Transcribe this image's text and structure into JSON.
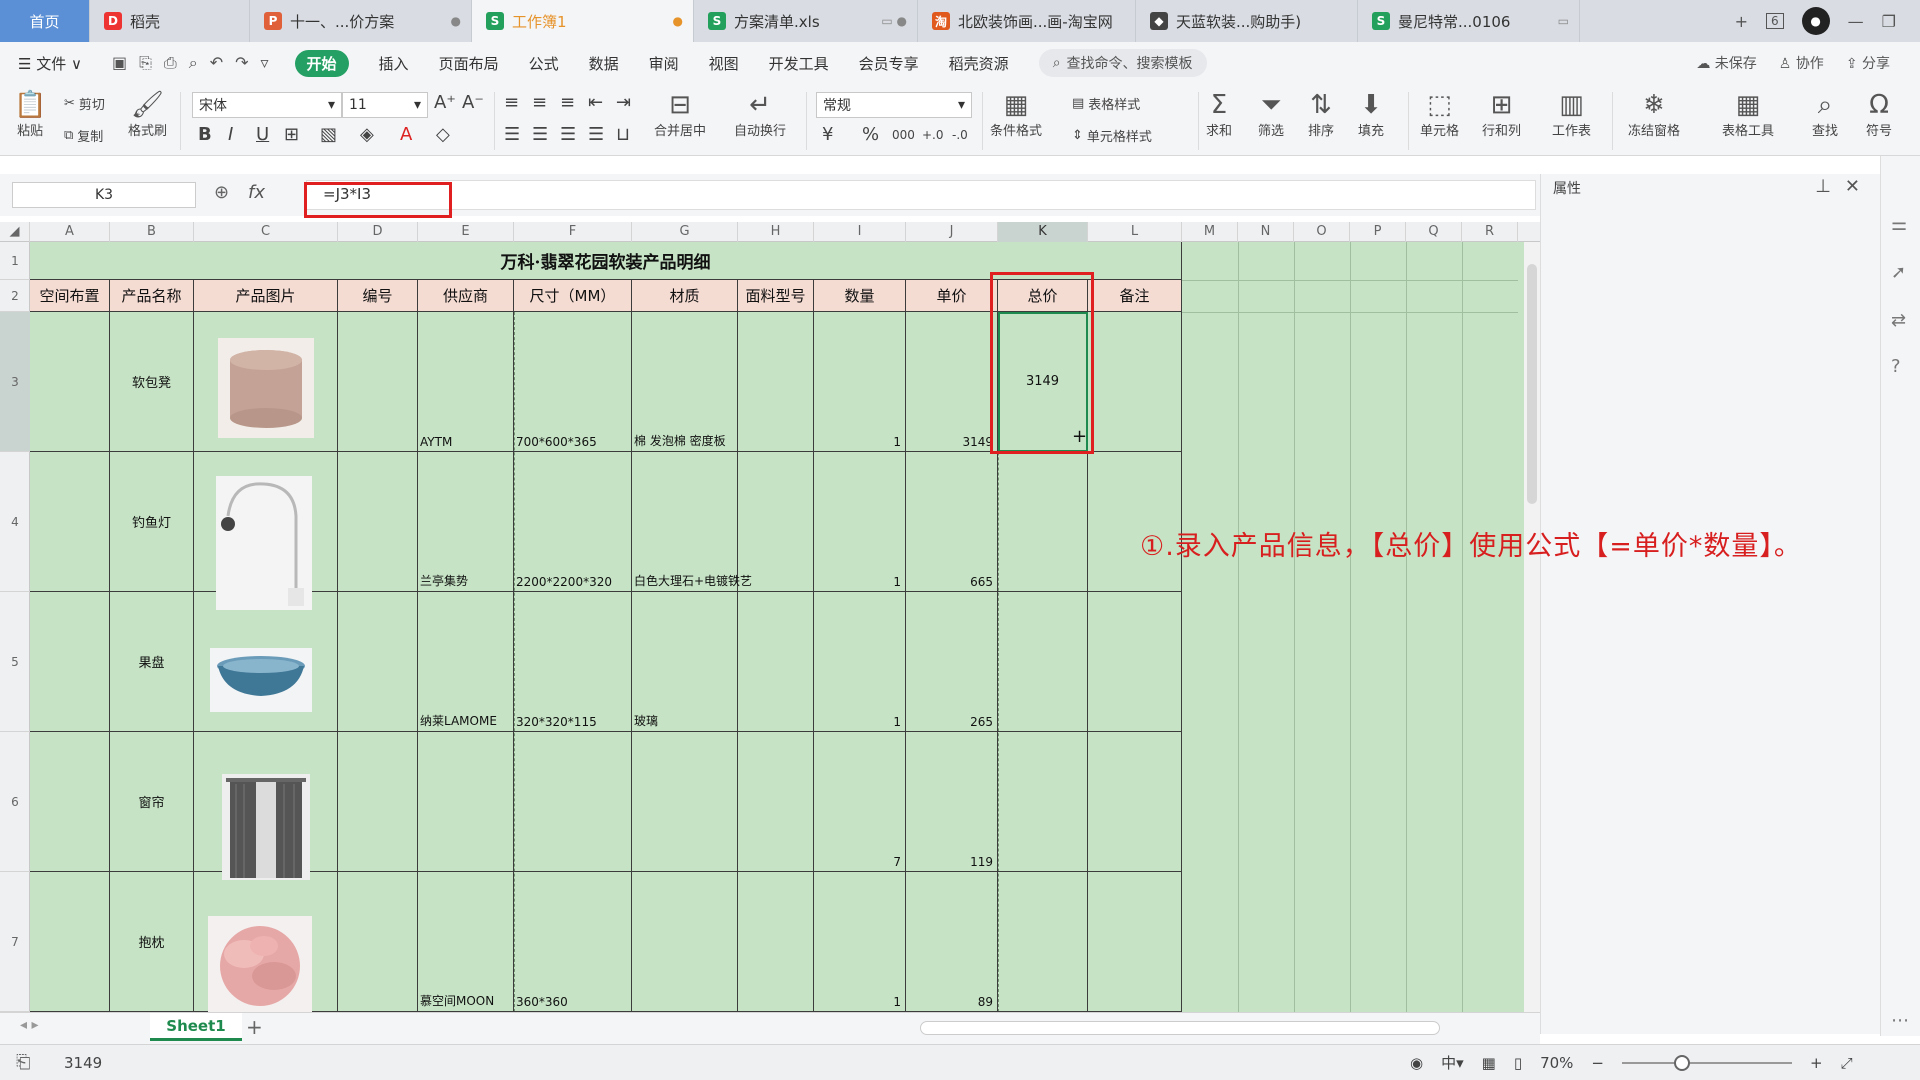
{
  "tabs": [
    {
      "label": "首页",
      "icon": ""
    },
    {
      "label": "稻壳",
      "icon": "D"
    },
    {
      "label": "十一、...价方案",
      "icon": "P"
    },
    {
      "label": "工作簿1",
      "icon": "S"
    },
    {
      "label": "方案清单.xls",
      "icon": "S"
    },
    {
      "label": "北欧装饰画...画-淘宝网",
      "icon": "淘"
    },
    {
      "label": "天蓝软装...购助手)",
      "icon": "◆"
    },
    {
      "label": "曼尼特常...0106",
      "icon": "S"
    }
  ],
  "tabbar_right": {
    "new_tab": "+",
    "badge": "6",
    "avatar": "●"
  },
  "menu": {
    "file": "☰ 文件 ∨",
    "items": [
      "开始",
      "插入",
      "页面布局",
      "公式",
      "数据",
      "审阅",
      "视图",
      "开发工具",
      "会员专享",
      "稻壳资源"
    ],
    "search": "查找命令、搜索模板",
    "unsaved": "未保存",
    "collab": "协作",
    "share": "分享"
  },
  "ribbon": {
    "paste": "粘贴",
    "cut": "剪切",
    "copy": "复制",
    "format_painter": "格式刷",
    "font_name": "宋体",
    "font_size": "11",
    "merge": "合并居中",
    "wrap": "自动换行",
    "number_format": "常规",
    "cond_format": "条件格式",
    "table_style": "表格样式",
    "cell_style": "单元格样式",
    "sum": "求和",
    "filter": "筛选",
    "sort": "排序",
    "fill": "填充",
    "cell": "单元格",
    "rowcol": "行和列",
    "sheet": "工作表",
    "freeze": "冻结窗格",
    "table_tools": "表格工具",
    "find": "查找",
    "symbol": "符号"
  },
  "formula_bar": {
    "name_box": "K3",
    "fx": "fx",
    "formula": "=J3*I3"
  },
  "properties": {
    "title": "属性"
  },
  "columns": [
    "A",
    "B",
    "C",
    "D",
    "E",
    "F",
    "G",
    "H",
    "I",
    "J",
    "K",
    "L",
    "M",
    "N",
    "O",
    "P",
    "Q",
    "R"
  ],
  "rows": [
    "1",
    "2",
    "3",
    "4",
    "5",
    "6",
    "7"
  ],
  "sheet_title": "万科·翡翠花园软装产品明细",
  "headers": [
    "空间布置",
    "产品名称",
    "产品图片",
    "编号",
    "供应商",
    "尺寸（MM）",
    "材质",
    "面料型号",
    "数量",
    "单价",
    "总价",
    "备注"
  ],
  "products": [
    {
      "name": "软包凳",
      "supplier": "AYTM",
      "size": "700*600*365",
      "material": "棉 发泡棉 密度板",
      "qty": "1",
      "price": "3149",
      "total": "3149"
    },
    {
      "name": "钓鱼灯",
      "supplier": "兰亭集势",
      "size": "2200*2200*320",
      "material": "白色大理石+电镀铁艺",
      "qty": "1",
      "price": "665",
      "total": ""
    },
    {
      "name": "果盘",
      "supplier": "纳莱LAMOME",
      "size": "320*320*115",
      "material": "玻璃",
      "qty": "1",
      "price": "265",
      "total": ""
    },
    {
      "name": "窗帘",
      "supplier": "",
      "size": "",
      "material": "",
      "qty": "7",
      "price": "119",
      "total": ""
    },
    {
      "name": "抱枕",
      "supplier": "慕空间MOON",
      "size": "360*360",
      "material": "",
      "qty": "1",
      "price": "89",
      "total": ""
    }
  ],
  "annotation": "①.录入产品信息，【总价】使用公式【=单价*数量】。",
  "sheet_tab": "Sheet1",
  "status": {
    "value": "3149",
    "zoom": "70%"
  },
  "colors": {
    "accent": "#1e8a4d",
    "highlight": "#e02020",
    "header_fill": "#f5dcd3",
    "cell_fill": "#c6e4c5"
  }
}
